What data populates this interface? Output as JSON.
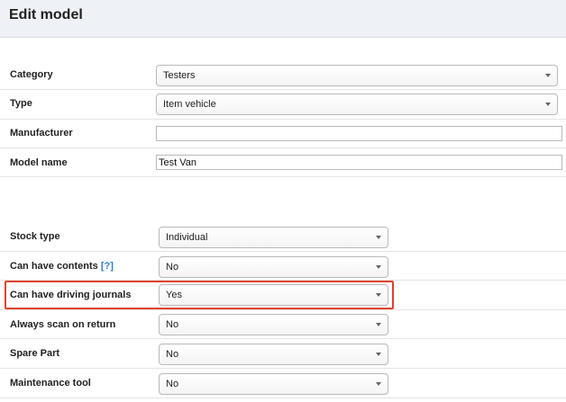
{
  "header": {
    "title": "Edit model"
  },
  "fields": {
    "category": {
      "label": "Category",
      "value": "Testers"
    },
    "type": {
      "label": "Type",
      "value": "Item vehicle"
    },
    "manufacturer": {
      "label": "Manufacturer",
      "value": ""
    },
    "model_name": {
      "label": "Model name",
      "value": "Test Van"
    },
    "stock_type": {
      "label": "Stock type",
      "value": "Individual"
    },
    "can_have_contents": {
      "label": "Can have contents",
      "help": "[?]",
      "value": "No"
    },
    "driving_journals": {
      "label": "Can have driving journals",
      "value": "Yes"
    },
    "always_scan": {
      "label": "Always scan on return",
      "value": "No"
    },
    "spare_part": {
      "label": "Spare Part",
      "value": "No"
    },
    "maintenance_tool": {
      "label": "Maintenance tool",
      "value": "No"
    }
  },
  "colors": {
    "highlight": "#e0442a",
    "header_bg": "#eef1f6",
    "link": "#2f7fd1"
  }
}
